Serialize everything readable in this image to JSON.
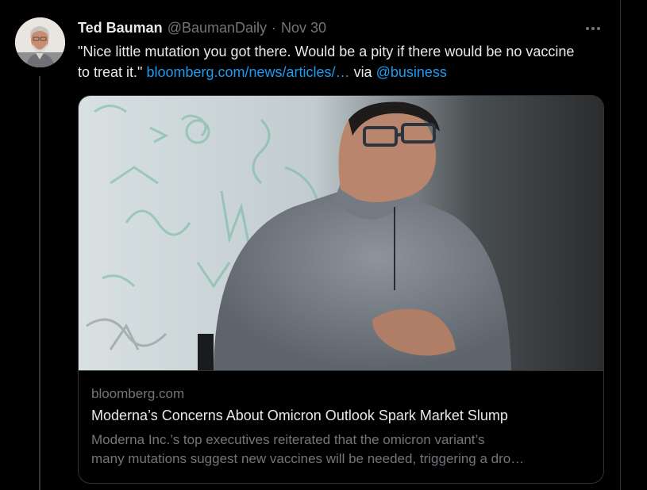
{
  "tweet": {
    "display_name": "Ted Bauman",
    "handle": "@BaumanDaily",
    "separator": "·",
    "date": "Nov 30",
    "text_before_link": "\"Nice little mutation you got there. Would be a pity if there would be no vaccine to treat it.\"",
    "link": "bloomberg.com/news/articles/…",
    "via_text": "via",
    "mention": "@business",
    "more_icon": "ellipsis-icon"
  },
  "card": {
    "domain": "bloomberg.com",
    "title": "Moderna’s Concerns About Omicron Outlook Spark Market Slump",
    "description_line1": "Moderna Inc.’s top executives reiterated that the omicron variant’s",
    "description_line2": "many mutations suggest new vaccines will be needed, triggering a dro…"
  },
  "colors": {
    "background": "#000000",
    "text": "#e7e9ea",
    "muted": "#71767b",
    "link": "#1d9bf0",
    "border": "#2f3336"
  }
}
